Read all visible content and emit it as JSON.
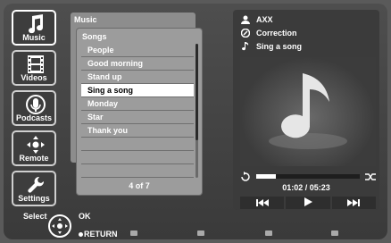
{
  "sidebar": {
    "items": [
      {
        "label": "Music",
        "icon": "music-note-icon"
      },
      {
        "label": "Videos",
        "icon": "film-strip-icon"
      },
      {
        "label": "Podcasts",
        "icon": "microphone-icon"
      },
      {
        "label": "Remote",
        "icon": "dpad-icon"
      },
      {
        "label": "Settings",
        "icon": "wrench-icon"
      }
    ]
  },
  "breadcrumb": {
    "root": "Music",
    "current": "Songs"
  },
  "songs": {
    "items": [
      "People",
      "Good morning",
      "Stand up",
      "Sing a song",
      "Monday",
      "Star",
      "Thank you"
    ],
    "selected_index": 3,
    "page": "4 of 7"
  },
  "now_playing": {
    "artist": "AXX",
    "album": "Correction",
    "song": "Sing a song",
    "time": "01:02 / 05:23",
    "progress": 0.19
  },
  "help": {
    "select": "Select",
    "ok": "OK",
    "return": "RETURN"
  }
}
